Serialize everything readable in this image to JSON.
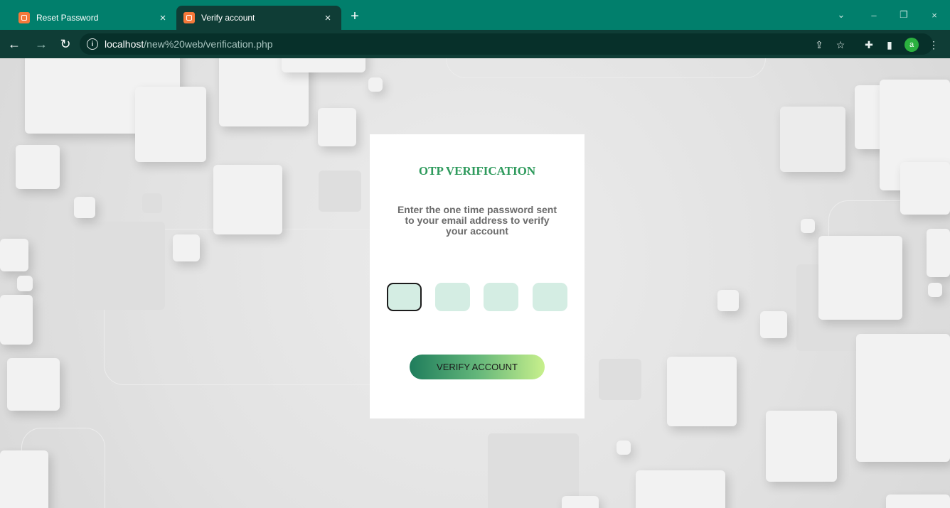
{
  "browser": {
    "tabs": [
      {
        "title": "Reset Password",
        "active": false,
        "icon": "xampp-favicon-icon"
      },
      {
        "title": "Verify account",
        "active": true,
        "icon": "xampp-favicon-icon"
      }
    ],
    "new_tab_label": "+",
    "close_glyph": "×",
    "window_controls": {
      "dropdown": "⌄",
      "minimize": "–",
      "restore": "❐",
      "close": "×"
    },
    "nav": {
      "back": "←",
      "forward": "→",
      "reload": "↻"
    },
    "url": {
      "host": "localhost",
      "path": "/new%20web/verification.php",
      "info_glyph": "i"
    },
    "toolbar_icons": {
      "share": "⇪",
      "bookmark": "☆",
      "extensions": "✚",
      "sidepanel": "▮",
      "menu": "⋮"
    },
    "profile_initial": "a",
    "colors": {
      "tabbar": "#017f6c",
      "toolbar": "#0f3d36",
      "profile": "#2bb03f"
    }
  },
  "card": {
    "title": "OTP VERIFICATION",
    "description": "Enter the one time password sent to your email address to verify your account",
    "otp_fields": [
      "",
      "",
      "",
      ""
    ],
    "focused_index": 0,
    "button_label": "VERIFY ACCOUNT",
    "colors": {
      "title": "#2e9a5c",
      "otp_fill": "#d4ede3",
      "button_start": "#1f7d5c",
      "button_end": "#c8f08c"
    }
  }
}
